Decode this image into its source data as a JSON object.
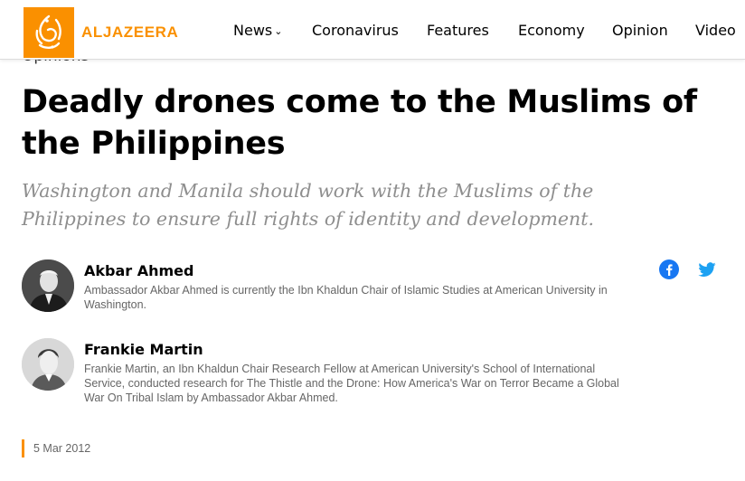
{
  "brand": {
    "name": "ALJAZEERA",
    "color": "#fa9000"
  },
  "nav": {
    "items": [
      {
        "label": "News",
        "has_dropdown": true
      },
      {
        "label": "Coronavirus"
      },
      {
        "label": "Features"
      },
      {
        "label": "Economy"
      },
      {
        "label": "Opinion"
      },
      {
        "label": "Video"
      }
    ]
  },
  "article": {
    "section": "Opinions",
    "headline": "Deadly drones come to the Muslims of the Philippines",
    "standfirst": "Washington and Manila should work with the Muslims of the Philippines to ensure full rights of identity and development.",
    "date": "5 Mar 2012"
  },
  "authors": [
    {
      "name": "Akbar Ahmed",
      "bio": "Ambassador Akbar Ahmed is currently the Ibn Khaldun Chair of Islamic Studies at American University in Washington."
    },
    {
      "name": "Frankie Martin",
      "bio": "Frankie Martin, an Ibn Khaldun Chair Research Fellow at American University's School of International Service, conducted research for The Thistle and the Drone: How America's War on Terror Became a Global War On Tribal Islam by Ambassador Akbar Ahmed."
    }
  ],
  "share": {
    "facebook_icon": "facebook-icon",
    "facebook_color": "#1877f2",
    "twitter_icon": "twitter-icon",
    "twitter_color": "#1da1f2"
  }
}
